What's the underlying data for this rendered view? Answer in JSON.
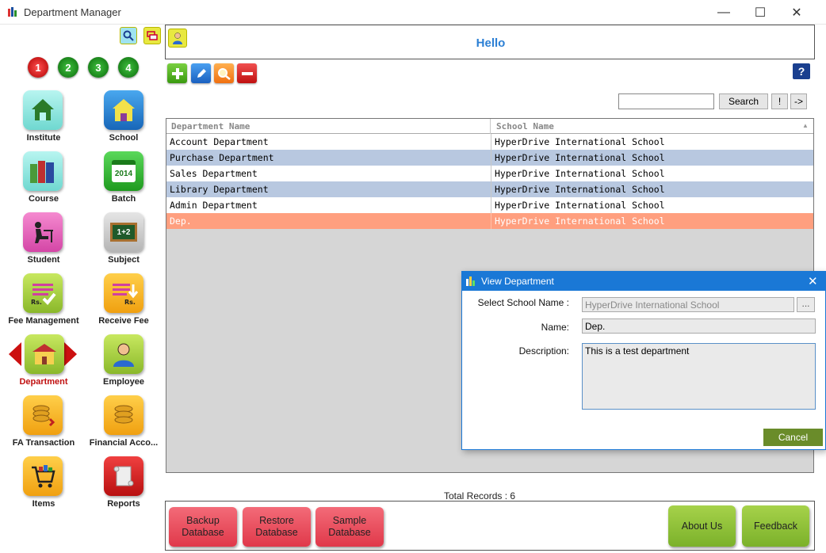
{
  "window": {
    "title": "Department Manager",
    "minimize": "—",
    "maximize": "☐",
    "close": "✕"
  },
  "sidebar": {
    "steps": [
      "1",
      "2",
      "3",
      "4"
    ],
    "tiles": [
      {
        "label": "Institute"
      },
      {
        "label": "School"
      },
      {
        "label": "Course"
      },
      {
        "label": "Batch"
      },
      {
        "label": "Student"
      },
      {
        "label": "Subject"
      },
      {
        "label": "Fee Management"
      },
      {
        "label": "Receive Fee"
      },
      {
        "label": "Department"
      },
      {
        "label": "Employee"
      },
      {
        "label": "FA Transaction"
      },
      {
        "label": "Financial Acco..."
      },
      {
        "label": "Items"
      },
      {
        "label": "Reports"
      }
    ],
    "batch_year": "2014",
    "subject_text": "1+2",
    "fee_symbol": "Rs."
  },
  "header": {
    "greeting": "Hello"
  },
  "toolbar": {
    "help": "?"
  },
  "search": {
    "value": "",
    "button": "Search",
    "bang": "!",
    "arrow": "->"
  },
  "grid": {
    "columns": [
      "Department Name",
      "School Name"
    ],
    "rows": [
      [
        "Account Department",
        "HyperDrive International School"
      ],
      [
        "Purchase Department",
        "HyperDrive International School"
      ],
      [
        "Sales Department",
        "HyperDrive International School"
      ],
      [
        "Library Department",
        "HyperDrive International School"
      ],
      [
        "Admin Department",
        "HyperDrive International School"
      ],
      [
        "Dep.",
        "HyperDrive International School"
      ]
    ]
  },
  "total_records": "Total Records : 6",
  "bottom": {
    "backup": "Backup Database",
    "restore": "Restore Database",
    "sample": "Sample Database",
    "about": "About Us",
    "feedback": "Feedback"
  },
  "dialog": {
    "title": "View Department",
    "school_label": "Select School Name :",
    "school_value": "HyperDrive International School",
    "browse": "...",
    "name_label": "Name:",
    "name_value": "Dep.",
    "desc_label": "Description:",
    "desc_value": "This is a test department",
    "cancel": "Cancel"
  },
  "colors": {
    "row_alt": "#b8c8e0",
    "row_selected": "#ff9f7f",
    "accent": "#2b7fd4"
  }
}
